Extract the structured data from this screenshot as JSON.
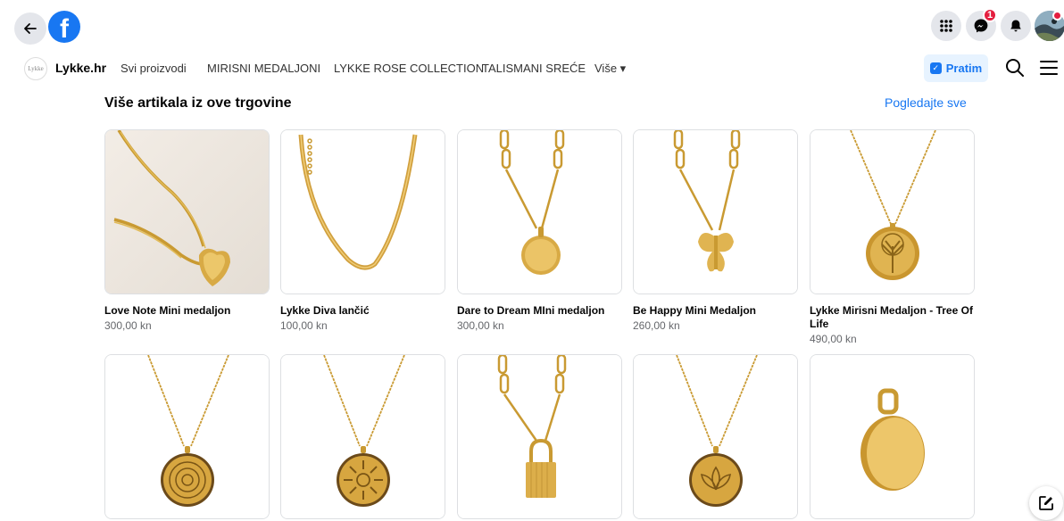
{
  "topbar": {
    "brand_letter": "f",
    "messenger_badge": "1"
  },
  "shop": {
    "logo_text": "Lykke",
    "name": "Lykke.hr",
    "nav": [
      "Svi proizvodi",
      "MIRISNI MEDALJONI",
      "LYKKE ROSE COLLECTION",
      "TALISMANI SREĆE"
    ],
    "more_label": "Više ▾",
    "follow_label": "Pratim"
  },
  "section": {
    "title": "Više artikala iz ove trgovine",
    "see_all": "Pogledajte sve"
  },
  "products": [
    {
      "name": "Love Note Mini medaljon",
      "price": "300,00 kn"
    },
    {
      "name": "Lykke Diva lančić",
      "price": "100,00 kn"
    },
    {
      "name": "Dare to Dream MIni medaljon",
      "price": "300,00 kn"
    },
    {
      "name": "Be Happy Mini Medaljon",
      "price": "260,00 kn"
    },
    {
      "name": "Lykke Mirisni Medaljon - Tree Of Life",
      "price": "490,00 kn"
    }
  ],
  "icons": {
    "back": "back-arrow-icon",
    "menu": "grid-menu-icon",
    "messenger": "messenger-icon",
    "notifications": "bell-icon",
    "search": "search-icon",
    "hamburger": "hamburger-icon",
    "edit": "compose-icon"
  },
  "colors": {
    "accent": "#1877f2",
    "gold": "#d9a93a",
    "badge": "#e41e3f"
  }
}
